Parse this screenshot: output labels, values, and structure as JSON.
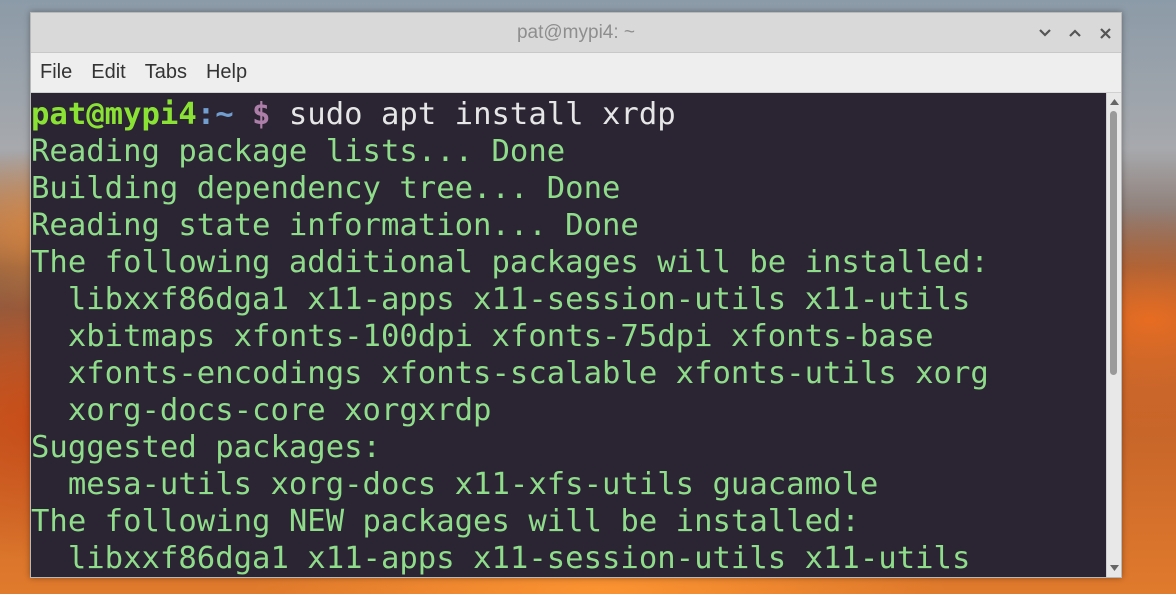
{
  "window": {
    "title": "pat@mypi4: ~",
    "controls": [
      "minimize-icon",
      "maximize-icon",
      "close-icon"
    ]
  },
  "menu": [
    "File",
    "Edit",
    "Tabs",
    "Help"
  ],
  "terminal": {
    "prompt_user": "pat@mypi4",
    "prompt_sep": ":",
    "prompt_path": "~",
    "prompt_symbol": "$",
    "command": "sudo apt install xrdp",
    "output": [
      "Reading package lists... Done",
      "Building dependency tree... Done",
      "Reading state information... Done",
      "The following additional packages will be installed:",
      "  libxxf86dga1 x11-apps x11-session-utils x11-utils",
      "  xbitmaps xfonts-100dpi xfonts-75dpi xfonts-base",
      "  xfonts-encodings xfonts-scalable xfonts-utils xorg",
      "  xorg-docs-core xorgxrdp",
      "Suggested packages:",
      "  mesa-utils xorg-docs x11-xfs-utils guacamole",
      "The following NEW packages will be installed:",
      "  libxxf86dga1 x11-apps x11-session-utils x11-utils"
    ]
  }
}
